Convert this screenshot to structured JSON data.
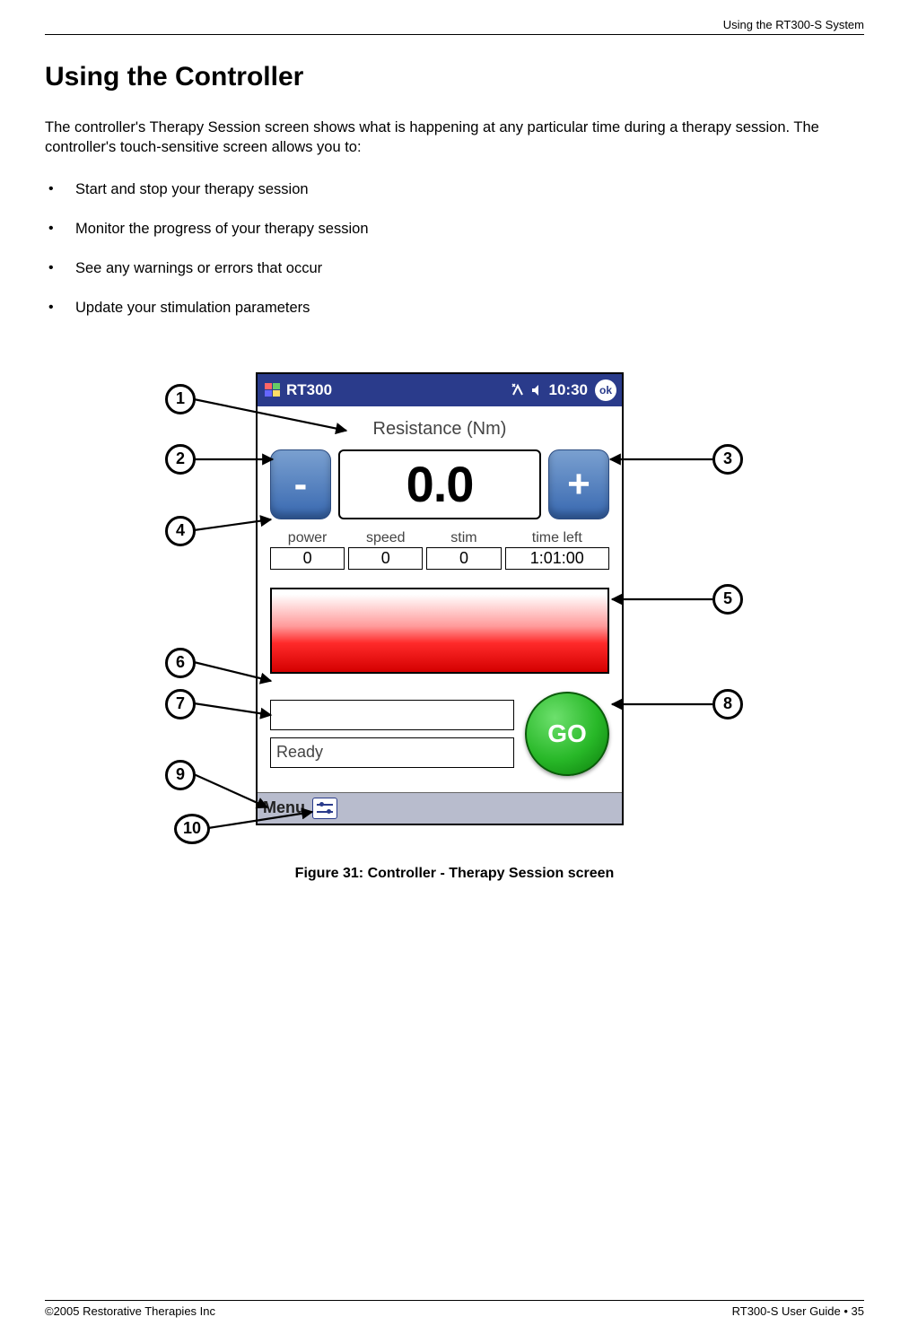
{
  "header": {
    "running": "Using the RT300-S System"
  },
  "title": "Using the Controller",
  "intro": "The controller's Therapy Session screen shows what is happening at any particular time during a therapy session.  The controller's touch-sensitive screen allows you to:",
  "bullets": [
    "Start and stop your therapy session",
    "Monitor the progress of your therapy session",
    "See any warnings or errors that occur",
    "Update your stimulation parameters"
  ],
  "device": {
    "titlebar": {
      "app_name": "RT300",
      "time": "10:30",
      "ok": "ok"
    },
    "resistance_label": "Resistance (Nm)",
    "resistance_value": "0.0",
    "minus": "-",
    "plus": "+",
    "metrics": {
      "power": {
        "label": "power",
        "value": "0"
      },
      "speed": {
        "label": "speed",
        "value": "0"
      },
      "stim": {
        "label": "stim",
        "value": "0"
      },
      "timeleft": {
        "label": "time left",
        "value": "1:01:00"
      }
    },
    "status_upper": "",
    "status_lower": "Ready",
    "go": "GO",
    "menu": "Menu"
  },
  "callouts": {
    "c1": "1",
    "c2": "2",
    "c3": "3",
    "c4": "4",
    "c5": "5",
    "c6": "6",
    "c7": "7",
    "c8": "8",
    "c9": "9",
    "c10": "10"
  },
  "caption": "Figure 31: Controller - Therapy Session screen",
  "footer": {
    "left": "©2005 Restorative Therapies Inc",
    "right": "RT300-S User Guide • 35"
  }
}
